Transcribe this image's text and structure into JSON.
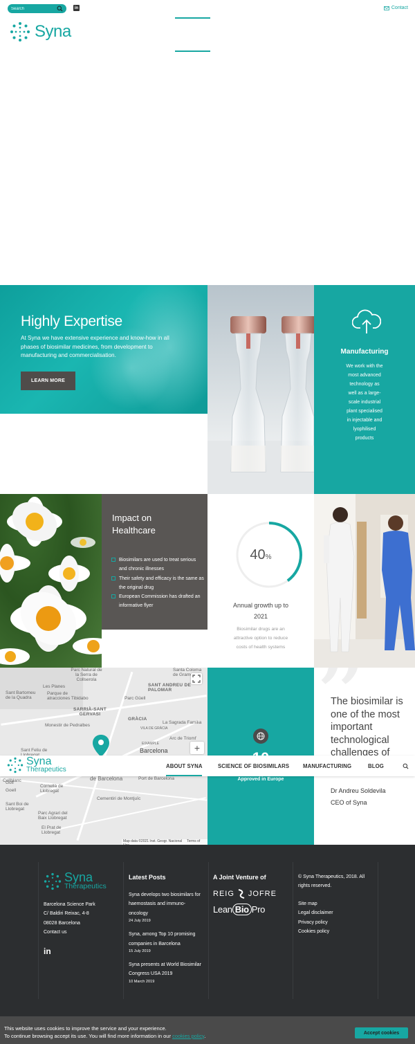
{
  "topbar": {
    "search_placeholder": "Search",
    "contact_label": "Contact"
  },
  "brand": {
    "name": "Syna",
    "sub": "Therapeutics",
    "accent_color": "#17a7a2"
  },
  "hero": {
    "title": "Highly Expertise",
    "text": "At Syna we have extensive experience and know-how in all phases of biosimilar medicines, from development to manufacturing and commercialisation.",
    "button": "LEARN MORE"
  },
  "manufacturing": {
    "icon": "cloud-upload-icon",
    "title": "Manufacturing",
    "text": "We work with the most advanced technology as well as a large-scale industrial plant specialised in injectable and lyophilised products"
  },
  "impact": {
    "title": "Impact on Healthcare",
    "items": [
      "Biosimilars are used to treat serious and chronic illnesses",
      "Their safety and efficacy is the same as the original drug",
      "European Commission has drafted an informative flyer"
    ]
  },
  "growth": {
    "value": "40",
    "unit": "%",
    "ring_fraction": 0.4,
    "title": "Annual growth up to 2021",
    "text": "Biosimilar drugs are an attractive option to reduce costs of health systems"
  },
  "map": {
    "labels": [
      "Parc Natural de la Serra de Collserola",
      "Santa Coloma de Gramenet",
      "SANT ANDREU DE PALOMAR",
      "Sant Bartomeu de la Quadra",
      "Les Planes",
      "Parque de atracciones Tibidabo",
      "Parc Güell",
      "SARRIÀ-SANT GERVASI",
      "Monestir de Pedralbes",
      "GRÀCIA",
      "La Sagrada Familia",
      "VILA DE GRÀCIA",
      "Arc de Triomf",
      "Barcelona",
      "EIXAMPLE",
      "Sant Feliu de Llobregat",
      "Cornellà de Llobregat",
      "Collblanc",
      "Sant Boi de Llobregat",
      "Parc Agrari del Baix Llobregat",
      "El Prat de Llobregat",
      "Cementiri de Montjuïc",
      "Port de Barcelona",
      "de Barcelona",
      "Golf",
      "Goell"
    ],
    "credits": "Map data ©2021 Inst. Geogr. Nacional",
    "terms": "Terms of Use",
    "zoom_in": "+"
  },
  "approved": {
    "number": "10",
    "caption": "Approved in Europe"
  },
  "quote": {
    "text": "The biosimilar is one of the most important technological challenges of",
    "author": "Dr Andreu Soldevila",
    "role": "CEO of Syna"
  },
  "nav": {
    "items": [
      "ABOUT SYNA",
      "SCIENCE OF BIOSIMILARS",
      "MANUFACTURING",
      "BLOG"
    ]
  },
  "footer": {
    "address": [
      "Barcelona Science Park",
      "C/ Baldiri Reixac, 4-8",
      "08028 Barcelona",
      "Contact us"
    ],
    "latest_title": "Latest Posts",
    "posts": [
      {
        "title": "Syna develops two biosimilars for haemostasis and immuno-oncology",
        "date": "24 July 2019"
      },
      {
        "title": "Syna, among Top 10 promising companies in Barcelona",
        "date": "15 July 2019"
      },
      {
        "title": "Syna presents at World Biosimilar Congress USA 2019",
        "date": "10 March 2019"
      }
    ],
    "jv_title": "A Joint Venture of",
    "partner1_a": "REIG",
    "partner1_b": "JOFRE",
    "partner2_a": "Lean",
    "partner2_b": "Bio",
    "partner2_c": "Pro",
    "copyright": "© Syna Therapeutics, 2018. All rights reserved.",
    "links": [
      "Site map",
      "Legal disclaimer",
      "Privacy policy",
      "Cookies policy"
    ]
  },
  "cookie": {
    "line1": "This website uses cookies to improve the service and your experience.",
    "line2": "To continue browsing accept its use. You will find more information in our",
    "link": "cookies policy",
    "button": "Accept cookies"
  }
}
